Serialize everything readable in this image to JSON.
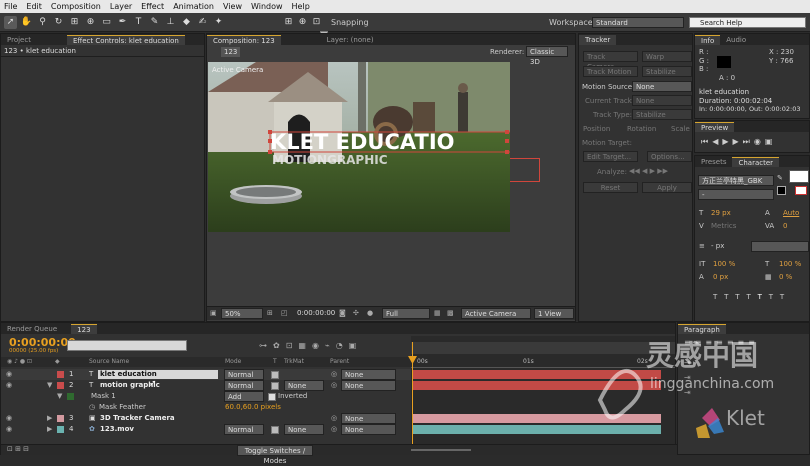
{
  "menu": [
    "File",
    "Edit",
    "Composition",
    "Layer",
    "Effect",
    "Animation",
    "View",
    "Window",
    "Help"
  ],
  "toolbar": {
    "snapping_label": "Snapping",
    "workspace_label": "Workspace:",
    "workspace_value": "Standard",
    "search_placeholder": "Search Help"
  },
  "project_panel": {
    "tab_project": "Project",
    "tab_effect_controls": "Effect Controls: klet education",
    "breadcrumb": "123 • klet education"
  },
  "composition_panel": {
    "tab_comp": "Composition: 123",
    "tab_layer": "Layer: (none)",
    "comp_badge": "123",
    "renderer_label": "Renderer:",
    "renderer_value": "Classic 3D",
    "active_camera_label": "Active Camera",
    "viewer_text_line1": "KLET EDUCATIO",
    "viewer_text_line2": "MOTIONGRAPHIC",
    "zoom": "50%",
    "timecode": "0:00:00:00",
    "resolution": "Full",
    "camera": "Active Camera",
    "views": "1 View"
  },
  "tracker_panel": {
    "title": "Tracker",
    "btn_track_camera": "Track Camera",
    "btn_warp": "Warp Stabilizer",
    "btn_track_motion": "Track Motion",
    "btn_stabilize": "Stabilize Motion",
    "motion_source_label": "Motion Source:",
    "motion_source_value": "None",
    "current_track_label": "Current Track:",
    "current_track_value": "None",
    "track_type_label": "Track Type:",
    "track_type_value": "Stabilize",
    "cb_position": "Position",
    "cb_rotation": "Rotation",
    "cb_scale": "Scale",
    "motion_target_label": "Motion Target:",
    "btn_edit_target": "Edit Target...",
    "btn_options": "Options...",
    "analyze_label": "Analyze:",
    "btn_reset": "Reset",
    "btn_apply": "Apply"
  },
  "info_panel": {
    "tab_info": "Info",
    "tab_audio": "Audio",
    "r": "R :",
    "g": "G :",
    "b": "B :",
    "a": "A : 0",
    "x": "X : 230",
    "y": "Y : 766",
    "layer_name": "klet education",
    "duration": "Duration: 0:00:02:04",
    "in_out": "In: 0:00:00:00, Out: 0:00:02:03"
  },
  "preview_panel": {
    "title": "Preview"
  },
  "character_panel": {
    "tab_presets": "Presets",
    "tab_character": "Character",
    "font_name": "方正兰亭特黑_GBK",
    "font_style": "-",
    "font_size": "29 px",
    "leading": "Auto",
    "kerning": "Metrics",
    "tracking": "0",
    "stroke": "- px",
    "vscale": "100 %",
    "hscale": "100 %",
    "baseline": "0 px",
    "tsume": "0 %"
  },
  "paragraph_panel": {
    "title": "Paragraph"
  },
  "timeline": {
    "tab_render_queue": "Render Queue",
    "tab_comp": "123",
    "timecode": "0:00:00:00",
    "fps": "00000 (25.00 fps)",
    "col_source": "Source Name",
    "col_mode": "Mode",
    "col_t": "T",
    "col_trkmat": "TrkMat",
    "col_parent": "Parent",
    "ruler": [
      "00s",
      "01s",
      "02s"
    ],
    "layers": [
      {
        "num": "1",
        "name": "klet education",
        "mode": "Normal",
        "trkmat": "",
        "parent": "None",
        "color": "#c94c4c"
      },
      {
        "num": "2",
        "name": "motion graphic",
        "mode": "Normal",
        "trkmat": "None",
        "parent": "None",
        "color": "#c94c4c"
      },
      {
        "num": "3",
        "name": "3D Tracker Camera",
        "mode": "",
        "trkmat": "",
        "parent": "None",
        "color": "#d39aa0"
      },
      {
        "num": "4",
        "name": "123.mov",
        "mode": "Normal",
        "trkmat": "None",
        "parent": "None",
        "color": "#6bb3b0"
      }
    ],
    "mask_name": "Mask 1",
    "mask_mode": "Add",
    "mask_inverted": "Inverted",
    "mask_feather_label": "Mask Feather",
    "mask_feather_value": "60.0,60.0 pixels",
    "toggle_switches": "Toggle Switches / Modes"
  },
  "watermark": {
    "cn": "灵感中国",
    "url": "lingganchina.com",
    "brand": "Klet"
  }
}
